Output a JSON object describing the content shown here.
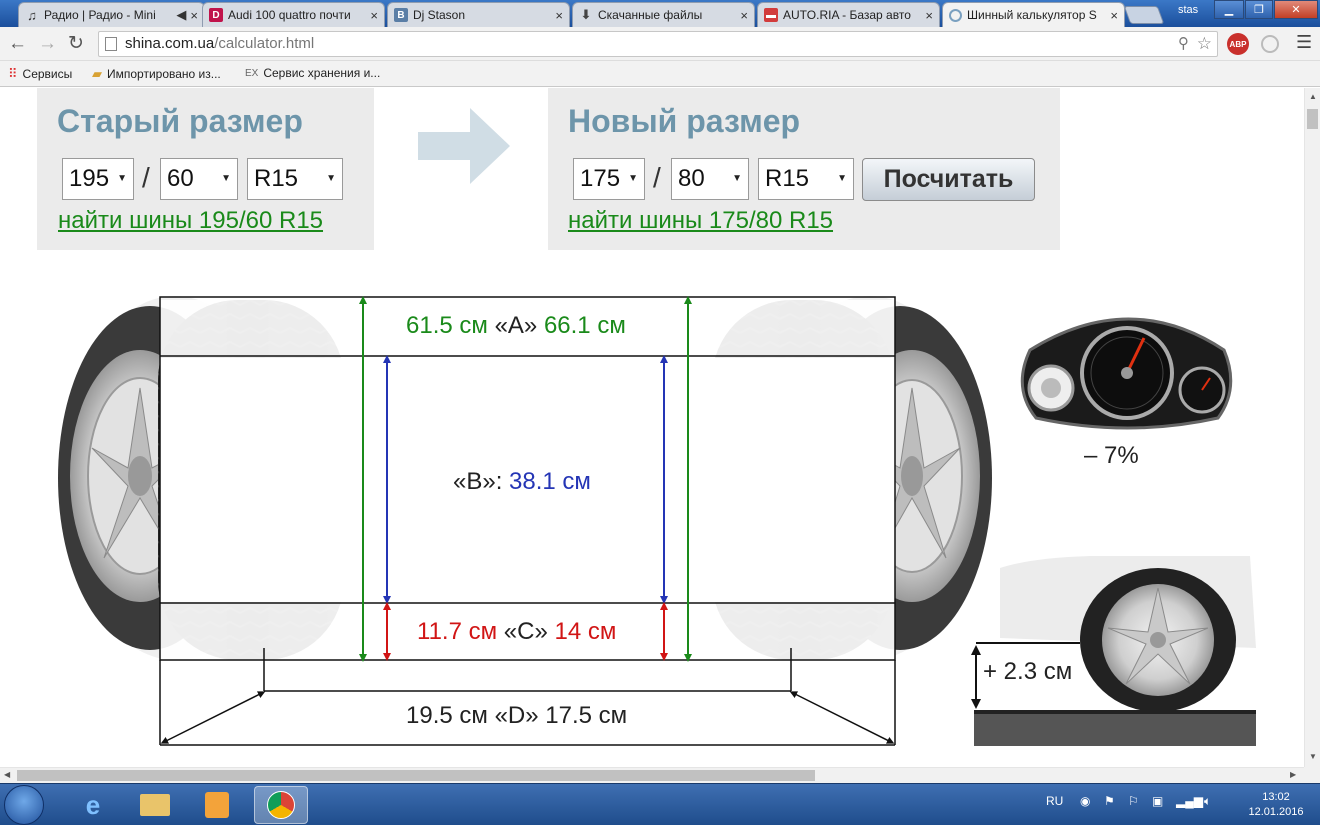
{
  "browser": {
    "tabs": [
      {
        "title": "Радио | Радио - Mini",
        "icon": "music-note-icon"
      },
      {
        "title": "Audi 100 quattro почти",
        "icon": "d-logo-icon"
      },
      {
        "title": "Dj Stason",
        "icon": "b-logo-icon"
      },
      {
        "title": "Скачанные файлы",
        "icon": "download-icon"
      },
      {
        "title": "AUTO.RIA - Базар авто",
        "icon": "car-icon"
      },
      {
        "title": "Шинный калькулятор S",
        "icon": "shina-logo-icon"
      }
    ],
    "user": "stas",
    "url_host": "shina.com.ua",
    "url_path": "/calculator.html",
    "adblock_label": "ABP",
    "bookmarks": [
      {
        "label": "Сервисы",
        "icon": "apps-grid-icon"
      },
      {
        "label": "Импортировано из...",
        "icon": "folder-icon"
      },
      {
        "label": "Сервис хранения и...",
        "icon": "ex-icon"
      }
    ],
    "bookmark_ex": "EX"
  },
  "calculator": {
    "old": {
      "title": "Старый размер",
      "width": "195",
      "profile": "60",
      "rim": "R15",
      "link": "найти шины 195/60 R15"
    },
    "new": {
      "title": "Новый размер",
      "width": "175",
      "profile": "80",
      "rim": "R15",
      "link": "найти шины 175/80 R15"
    },
    "separator": "/",
    "calc_button": "Посчитать"
  },
  "diagram": {
    "a_old": "61.5 см",
    "a_label": "«A»",
    "a_new": "66.1 см",
    "b_label": "«B»:",
    "b_value": "38.1 см",
    "c_old": "11.7 см",
    "c_label": "«C»",
    "c_new": "14 см",
    "d_old": "19.5 см",
    "d_label": "«D»",
    "d_new": "17.5 см",
    "speed_change": "– 7%",
    "clearance_change": "+ 2.3 см"
  },
  "taskbar": {
    "lang": "RU",
    "time": "13:02",
    "date": "12.01.2016"
  },
  "colors": {
    "green": "#1a8a1a",
    "blue": "#2435b5",
    "red": "#d11515",
    "title_blue": "#6d95aa"
  }
}
